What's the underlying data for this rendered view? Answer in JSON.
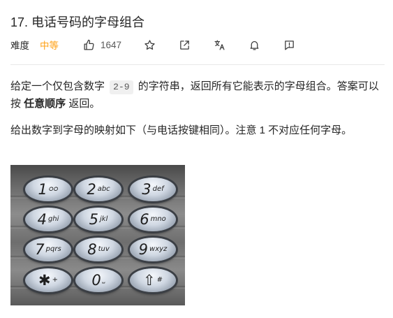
{
  "problem": {
    "title": "17. 电话号码的字母组合",
    "difficulty_label": "难度",
    "difficulty": "中等",
    "likes": "1647"
  },
  "toolbar": {
    "icons": [
      "thumbs-up-icon",
      "star-icon",
      "share-icon",
      "translate-icon",
      "bell-icon",
      "feedback-icon"
    ]
  },
  "description": {
    "p1_part1": "给定一个仅包含数字 ",
    "p1_code": "2-9",
    "p1_part2": " 的字符串，返回所有它能表示的字母组合。答案可以按 ",
    "p1_bold": "任意顺序",
    "p1_part3": " 返回。",
    "p2": "给出数字到字母的映射如下（与电话按键相同）。注意 1 不对应任何字母。"
  },
  "keypad": {
    "keys": [
      {
        "digit": "1",
        "letters": "ᴑᴑ"
      },
      {
        "digit": "2",
        "letters": "abc"
      },
      {
        "digit": "3",
        "letters": "def"
      },
      {
        "digit": "4",
        "letters": "ghi"
      },
      {
        "digit": "5",
        "letters": "jkl"
      },
      {
        "digit": "6",
        "letters": "mno"
      },
      {
        "digit": "7",
        "letters": "pqrs"
      },
      {
        "digit": "8",
        "letters": "tuv"
      },
      {
        "digit": "9",
        "letters": "wxyz"
      },
      {
        "digit": "✱",
        "letters": "+"
      },
      {
        "digit": "0",
        "letters": "⎵"
      },
      {
        "digit": "⇧",
        "letters": "#"
      }
    ]
  }
}
